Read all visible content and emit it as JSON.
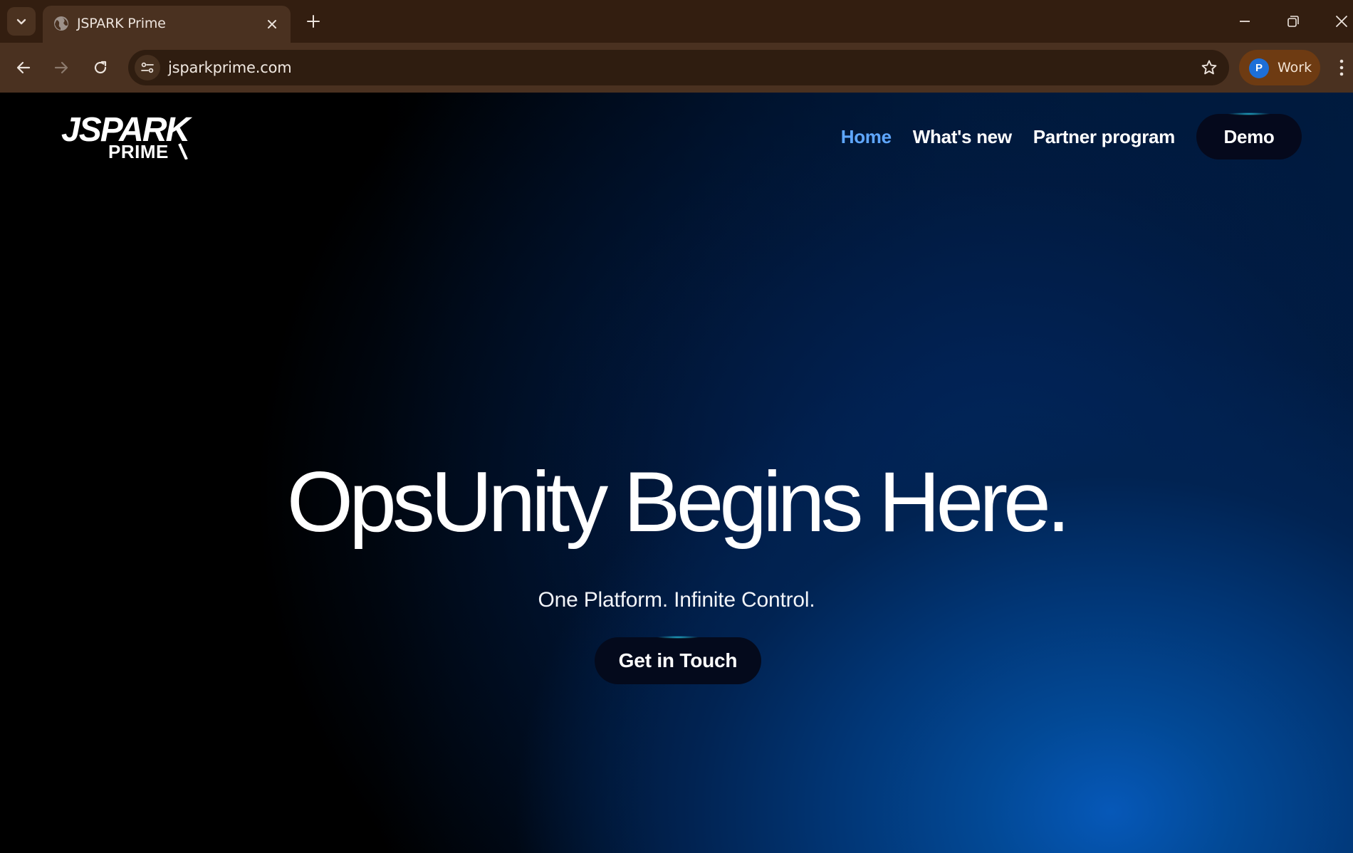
{
  "browser": {
    "tab_title": "JSPARK Prime",
    "url": "jsparkprime.com",
    "profile_initial": "P",
    "profile_name": "Work",
    "icons": [
      "tab-search-icon",
      "globe-icon",
      "close-icon",
      "plus-icon",
      "minimize-icon",
      "restore-icon",
      "window-close-icon",
      "back-arrow-icon",
      "forward-arrow-icon",
      "reload-icon",
      "site-settings-icon",
      "star-icon",
      "kebab-menu-icon"
    ]
  },
  "site": {
    "logo_top": "JSPARK",
    "logo_bottom": "PRIME",
    "nav": {
      "home": "Home",
      "whats_new": "What's new",
      "partner_program": "Partner program",
      "demo": "Demo"
    },
    "hero": {
      "title": "OpsUnity Begins Here.",
      "subtitle": "One Platform. Infinite Control.",
      "cta": "Get in Touch"
    }
  },
  "colors": {
    "tabstrip": "#331e10",
    "toolbar": "#4a3120",
    "nav_active": "#5fa7ff",
    "button_bg": "#05091c",
    "glow_blue": "#0658b8"
  }
}
